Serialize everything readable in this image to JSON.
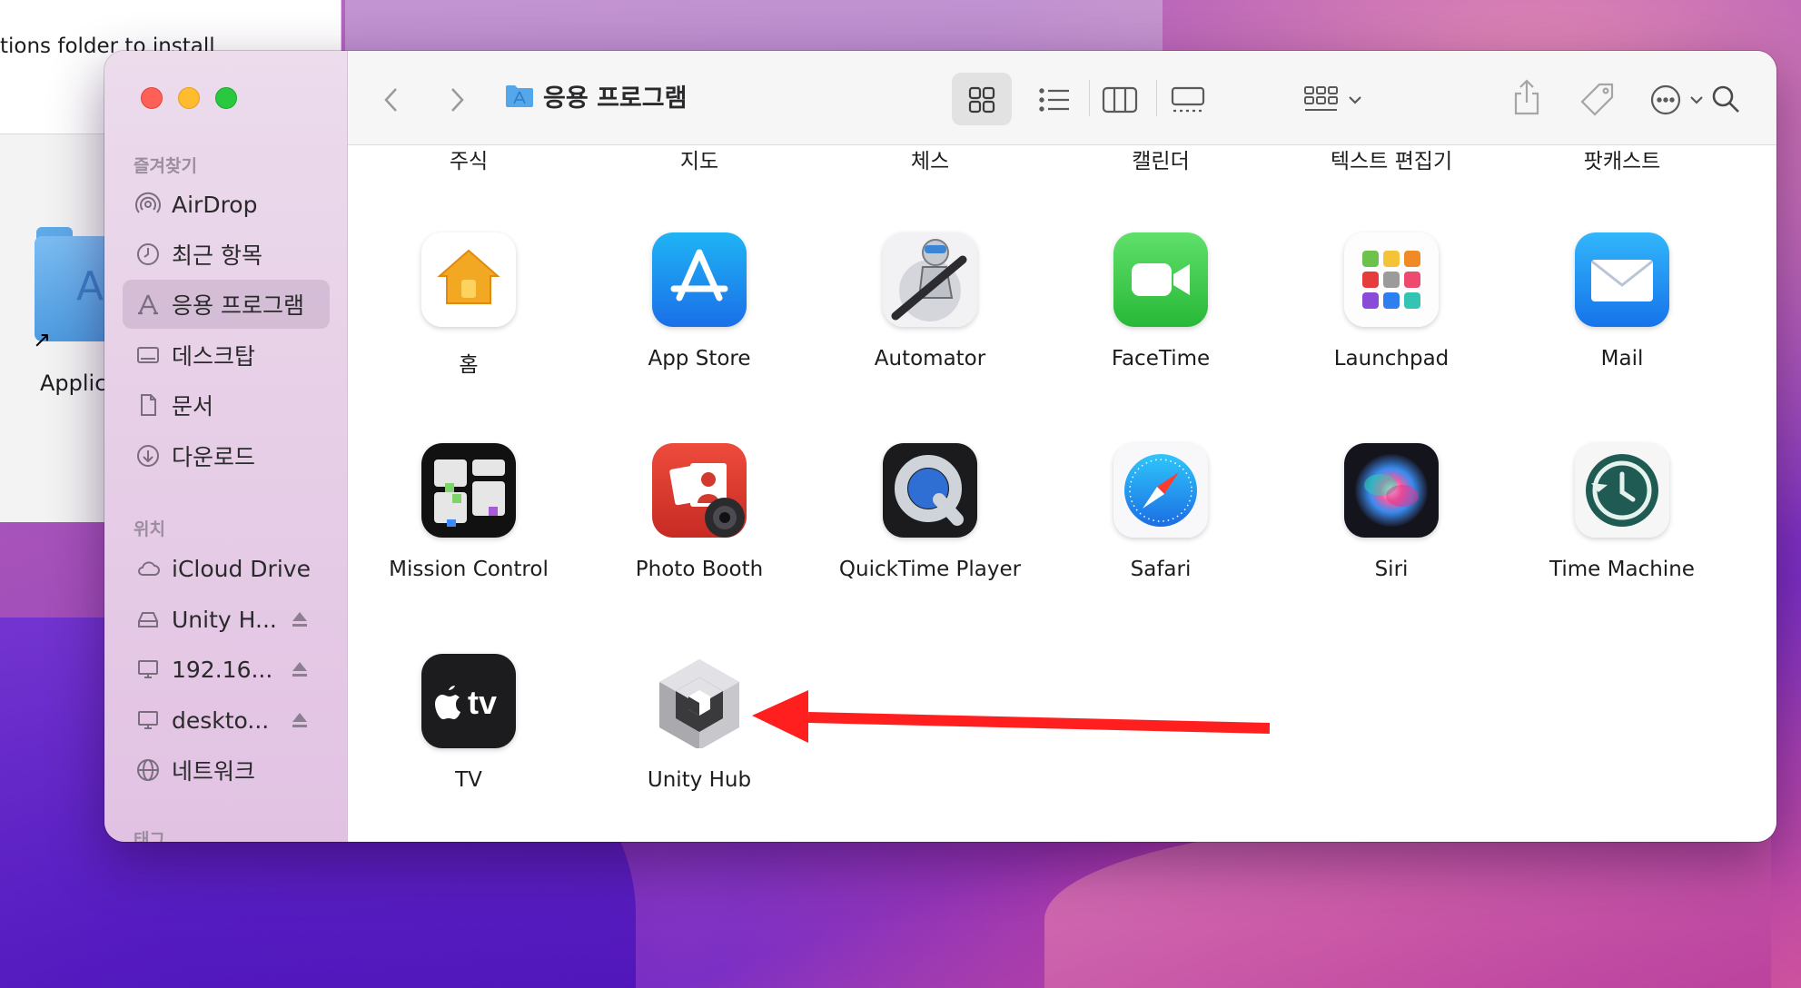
{
  "background_window": {
    "text": "tions folder to install",
    "folder_label": "Applic"
  },
  "window": {
    "title": "응용 프로그램"
  },
  "sidebar": {
    "favorites_header": "즐겨찾기",
    "favorites": [
      {
        "label": "AirDrop",
        "icon": "airdrop-icon"
      },
      {
        "label": "최근 항목",
        "icon": "clock-icon"
      },
      {
        "label": "응용 프로그램",
        "icon": "applications-icon",
        "selected": true
      },
      {
        "label": "데스크탑",
        "icon": "desktop-icon"
      },
      {
        "label": "문서",
        "icon": "document-icon"
      },
      {
        "label": "다운로드",
        "icon": "download-icon"
      }
    ],
    "locations_header": "위치",
    "locations": [
      {
        "label": "iCloud Drive",
        "icon": "cloud-icon"
      },
      {
        "label": "Unity H...",
        "icon": "disk-icon",
        "ejectable": true
      },
      {
        "label": "192.16...",
        "icon": "display-icon",
        "ejectable": true
      },
      {
        "label": "deskto...",
        "icon": "display-icon",
        "ejectable": true
      },
      {
        "label": "네트워크",
        "icon": "globe-icon"
      }
    ],
    "tags_header": "태그"
  },
  "top_row_cut_labels": [
    "주식",
    "지도",
    "체스",
    "캘린더",
    "텍스트 편집기",
    "팟캐스트"
  ],
  "apps": [
    {
      "label": "홈",
      "icon": "home-app-icon"
    },
    {
      "label": "App Store",
      "icon": "app-store-icon"
    },
    {
      "label": "Automator",
      "icon": "automator-icon"
    },
    {
      "label": "FaceTime",
      "icon": "facetime-icon"
    },
    {
      "label": "Launchpad",
      "icon": "launchpad-icon"
    },
    {
      "label": "Mail",
      "icon": "mail-icon"
    },
    {
      "label": "Mission Control",
      "icon": "mission-control-icon"
    },
    {
      "label": "Photo Booth",
      "icon": "photo-booth-icon"
    },
    {
      "label": "QuickTime Player",
      "icon": "quicktime-icon"
    },
    {
      "label": "Safari",
      "icon": "safari-icon"
    },
    {
      "label": "Siri",
      "icon": "siri-icon"
    },
    {
      "label": "Time Machine",
      "icon": "time-machine-icon"
    },
    {
      "label": "TV",
      "icon": "tv-icon",
      "icon_text": "tv"
    },
    {
      "label": "Unity Hub",
      "icon": "unity-hub-icon"
    }
  ],
  "annotation": {
    "color": "#ff1f1f"
  },
  "colors": {
    "close": "#fe5f57",
    "minimize": "#febc2e",
    "maximize": "#28c840",
    "folder_blue": "#4d9be0"
  }
}
